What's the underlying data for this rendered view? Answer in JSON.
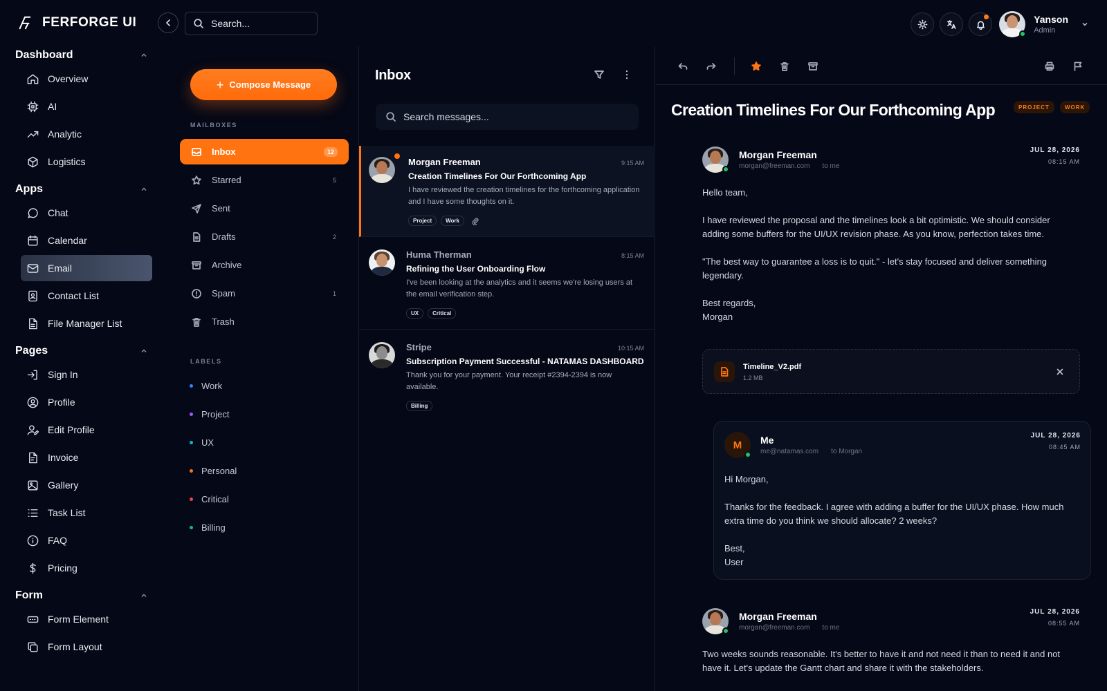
{
  "brand": {
    "name": "FERFORGE UI"
  },
  "sidebar": {
    "sections": [
      {
        "title": "Dashboard",
        "items": [
          "Overview",
          "AI",
          "Analytic",
          "Logistics"
        ]
      },
      {
        "title": "Apps",
        "items": [
          "Chat",
          "Calendar",
          "Email",
          "Contact List",
          "File Manager List"
        ]
      },
      {
        "title": "Pages",
        "items": [
          "Sign In",
          "Profile",
          "Edit Profile",
          "Invoice",
          "Gallery",
          "Task List",
          "FAQ",
          "Pricing"
        ]
      },
      {
        "title": "Form",
        "items": [
          "Form Element",
          "Form Layout"
        ]
      }
    ],
    "active_item": "Email"
  },
  "topbar": {
    "search_placeholder": "Search...",
    "user": {
      "name": "Yanson",
      "role": "Admin"
    }
  },
  "mailboxes": {
    "compose_label": "Compose Message",
    "caption": "MAILBOXES",
    "items": [
      {
        "label": "Inbox",
        "count": "12",
        "icon": "inbox-icon"
      },
      {
        "label": "Starred",
        "count": "5",
        "icon": "star-icon"
      },
      {
        "label": "Sent",
        "count": "",
        "icon": "send-icon"
      },
      {
        "label": "Drafts",
        "count": "2",
        "icon": "draft-icon"
      },
      {
        "label": "Archive",
        "count": "",
        "icon": "archive-icon"
      },
      {
        "label": "Spam",
        "count": "1",
        "icon": "spam-icon"
      },
      {
        "label": "Trash",
        "count": "",
        "icon": "trash-icon"
      }
    ],
    "labels_caption": "LABELS",
    "labels": [
      {
        "name": "Work",
        "color": "#3b82f6"
      },
      {
        "name": "Project",
        "color": "#a855f7"
      },
      {
        "name": "UX",
        "color": "#06b6d4"
      },
      {
        "name": "Personal",
        "color": "#f97316"
      },
      {
        "name": "Critical",
        "color": "#ef4444"
      },
      {
        "name": "Billing",
        "color": "#10b981"
      }
    ]
  },
  "inbox": {
    "title": "Inbox",
    "search_placeholder": "Search messages...",
    "messages": [
      {
        "from": "Morgan Freeman",
        "time": "9:15 AM",
        "subject": "Creation Timelines For Our Forthcoming App",
        "preview": "I have reviewed the creation timelines for the forthcoming application and I have some thoughts on it.",
        "tags": [
          "Project",
          "Work"
        ]
      },
      {
        "from": "Huma Therman",
        "time": "8:15 AM",
        "subject": "Refining the User Onboarding Flow",
        "preview": "I've been looking at the analytics and it seems we're losing users at the email verification step.",
        "tags": [
          "UX",
          "Critical"
        ]
      },
      {
        "from": "Stripe",
        "time": "10:15 AM",
        "subject": "Subscription Payment Successful - NATAMAS DASHBOARD",
        "preview": "Thank you for your payment. Your receipt #2394-2394 is now available.",
        "tags": [
          "Billing"
        ]
      }
    ]
  },
  "reader": {
    "subject": "Creation Timelines For Our Forthcoming App",
    "tags": [
      "PROJECT",
      "WORK"
    ],
    "thread": [
      {
        "name": "Morgan Freeman",
        "email": "morgan@freeman.com",
        "to": "to me",
        "date": "JUL 28, 2026",
        "time": "08:15 AM",
        "paragraphs": [
          "Hello team,",
          "I have reviewed the proposal and the timelines look a bit optimistic. We should consider adding some buffers for the UI/UX revision phase. As you know, perfection takes time.",
          "\"The best way to guarantee a loss is to quit.\" - let's stay focused and deliver something legendary.",
          "Best regards,\nMorgan"
        ]
      },
      {
        "name": "Me",
        "initial": "M",
        "email": "me@natamas.com",
        "to": "to Morgan",
        "date": "JUL 28, 2026",
        "time": "08:45 AM",
        "paragraphs": [
          "Hi Morgan,",
          "Thanks for the feedback. I agree with adding a buffer for the UI/UX phase. How much extra time do you think we should allocate? 2 weeks?",
          "Best,\nUser"
        ]
      },
      {
        "name": "Morgan Freeman",
        "email": "morgan@freeman.com",
        "to": "to me",
        "date": "JUL 28, 2026",
        "time": "08:55 AM",
        "paragraphs": [
          "Two weeks sounds reasonable. It's better to have it and not need it than to need it and not have it. Let's update the Gantt chart and share it with the stakeholders."
        ]
      }
    ],
    "attachment": {
      "name": "Timeline_V2.pdf",
      "size": "1.2 MB"
    }
  },
  "colors": {
    "accent": "#ff7411",
    "background": "#050816",
    "online": "#22c55e"
  }
}
